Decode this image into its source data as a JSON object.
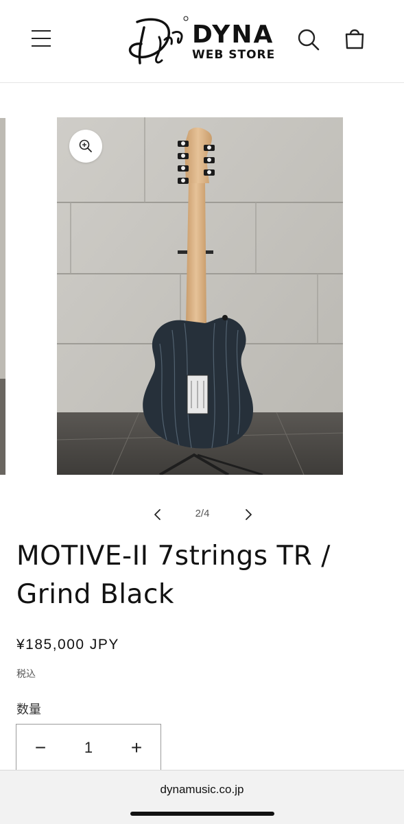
{
  "header": {
    "logo_script": "Dyna",
    "logo_brand": "DYNA",
    "logo_tagline": "WEB STORE",
    "icons": {
      "menu": "hamburger-menu-icon",
      "search": "search-icon",
      "cart": "cart-icon"
    }
  },
  "gallery": {
    "counter": "2/4",
    "icons": {
      "zoom": "zoom-in-icon",
      "prev": "chevron-left-icon",
      "next": "chevron-right-icon"
    }
  },
  "product": {
    "title": "MOTIVE-II 7strings TR / Grind Black",
    "price": "¥185,000 JPY",
    "tax_note": "税込",
    "quantity_label": "数量",
    "quantity_value": "1",
    "minus_symbol": "−",
    "plus_symbol": "+"
  },
  "browser": {
    "url": "dynamusic.co.jp"
  },
  "colors": {
    "text": "#121212",
    "border": "#e5e5e5",
    "guitar_body": "#26303a",
    "neck": "#d9b48a",
    "wall": "#c9c7c2"
  }
}
